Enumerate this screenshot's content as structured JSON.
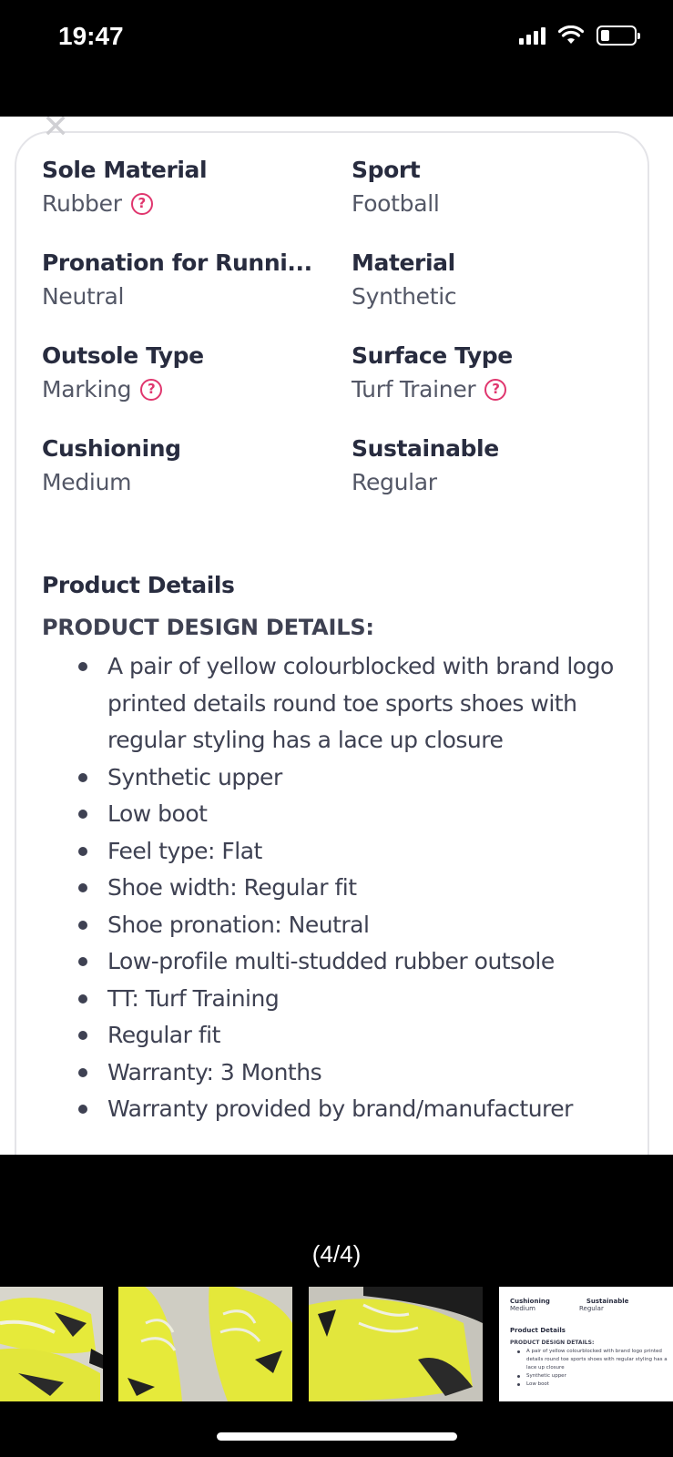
{
  "status_bar": {
    "time": "19:47",
    "icons": [
      "cellular-signal-icon",
      "wifi-icon",
      "battery-icon"
    ]
  },
  "specs": [
    {
      "label": "Sole Material",
      "value": "Rubber",
      "help": true
    },
    {
      "label": "Sport",
      "value": "Football",
      "help": false
    },
    {
      "label": "Pronation for Runni...",
      "value": "Neutral",
      "help": false
    },
    {
      "label": "Material",
      "value": "Synthetic",
      "help": false
    },
    {
      "label": "Outsole Type",
      "value": "Marking",
      "help": true
    },
    {
      "label": "Surface Type",
      "value": "Turf Trainer",
      "help": true
    },
    {
      "label": "Cushioning",
      "value": "Medium",
      "help": false
    },
    {
      "label": "Sustainable",
      "value": "Regular",
      "help": false
    }
  ],
  "details": {
    "title": "Product Details",
    "subtitle": "PRODUCT DESIGN DETAILS:",
    "items": [
      "A pair of yellow colourblocked with brand logo printed details round toe sports shoes with regular styling has a lace up closure",
      "Synthetic upper",
      "Low boot",
      "Feel type: Flat",
      "Shoe width: Regular fit",
      "Shoe pronation: Neutral",
      "Low-profile multi-studded rubber outsole",
      "TT: Turf Training",
      "Regular fit",
      "Warranty: 3 Months",
      "Warranty provided by brand/manufacturer"
    ]
  },
  "gallery": {
    "counter": "(4/4)",
    "thumb_preview": {
      "left_label": "Cushioning",
      "left_value": "Medium",
      "right_label": "Sustainable",
      "right_value": "Regular",
      "title": "Product Details",
      "subtitle": "PRODUCT DESIGN DETAILS:",
      "items": [
        "A pair of yellow colourblocked with brand logo printed details round toe sports shoes with regular styling has a lace up closure",
        "Synthetic upper",
        "Low boot"
      ]
    }
  },
  "colors": {
    "accent": "#e0366e",
    "shoe_yellow": "#e8ec3c",
    "text_dark": "#282c3f",
    "text_muted": "#535766"
  }
}
